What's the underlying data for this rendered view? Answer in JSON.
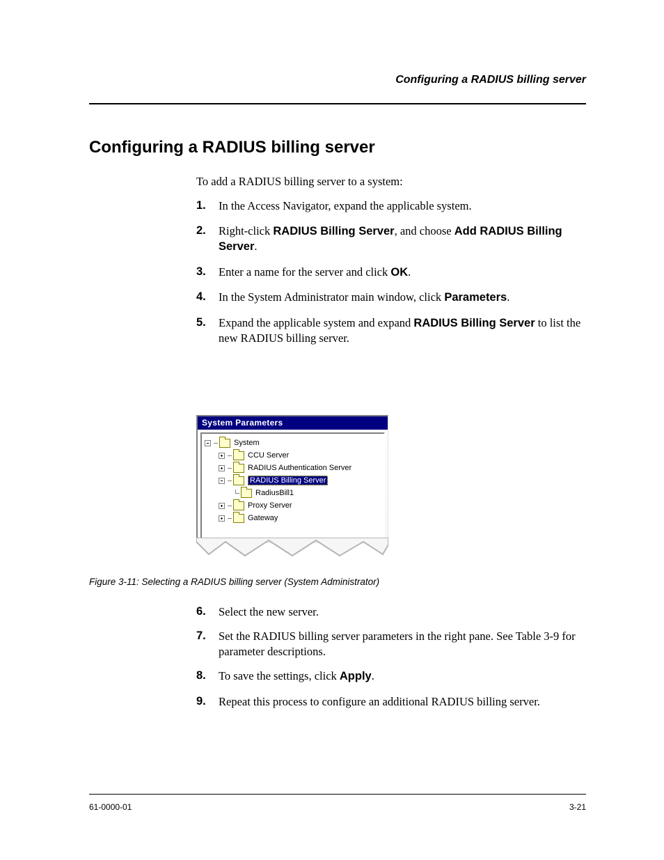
{
  "header": {
    "right": "Configuring a RADIUS billing server"
  },
  "h1": "Configuring a RADIUS billing server",
  "intro": "To add a RADIUS billing server to a system:",
  "steps_before": [
    {
      "num": "1.",
      "html": "In the Access Navigator, expand the applicable system."
    },
    {
      "num": "2.",
      "html": "Right-click <span class=\"label\">RADIUS Billing Server</span>, and choose <span class=\"label\">Add RADIUS Billing Server</span>."
    },
    {
      "num": "3.",
      "html": "Enter a name for the server and click <span class=\"label\">OK</span>."
    },
    {
      "num": "4.",
      "html": "In the System Administrator main window, click <span class=\"label\">Parameters</span>."
    },
    {
      "num": "5.",
      "html": "Expand the applicable system and expand <span class=\"label\">RADIUS Billing Server</span> to list the new RADIUS billing server."
    }
  ],
  "panel": {
    "title": "System Parameters",
    "tree": {
      "root": "System",
      "children": [
        {
          "label": "CCU Server",
          "state": "plus"
        },
        {
          "label": "RADIUS Authentication Server",
          "state": "plus"
        },
        {
          "label": "RADIUS Billing Server",
          "state": "minus",
          "selected": true,
          "children": [
            {
              "label": "RadiusBill1"
            }
          ]
        },
        {
          "label": "Proxy Server",
          "state": "plus"
        },
        {
          "label": "Gateway",
          "state": "plus"
        }
      ]
    }
  },
  "caption": "Figure 3-11: Selecting a RADIUS billing server (System Administrator)",
  "steps_after": [
    {
      "num": "6.",
      "html": "Select the new server."
    },
    {
      "num": "7.",
      "html": "Set the RADIUS billing server parameters in the right pane. See Table 3-9 for parameter descriptions."
    },
    {
      "num": "8.",
      "html": "To save the settings, click <span class=\"label\">Apply</span>."
    },
    {
      "num": "9.",
      "html": "Repeat this process to configure an additional RADIUS billing server."
    }
  ],
  "footer": {
    "left": "61-0000-01",
    "right": "3-21"
  }
}
